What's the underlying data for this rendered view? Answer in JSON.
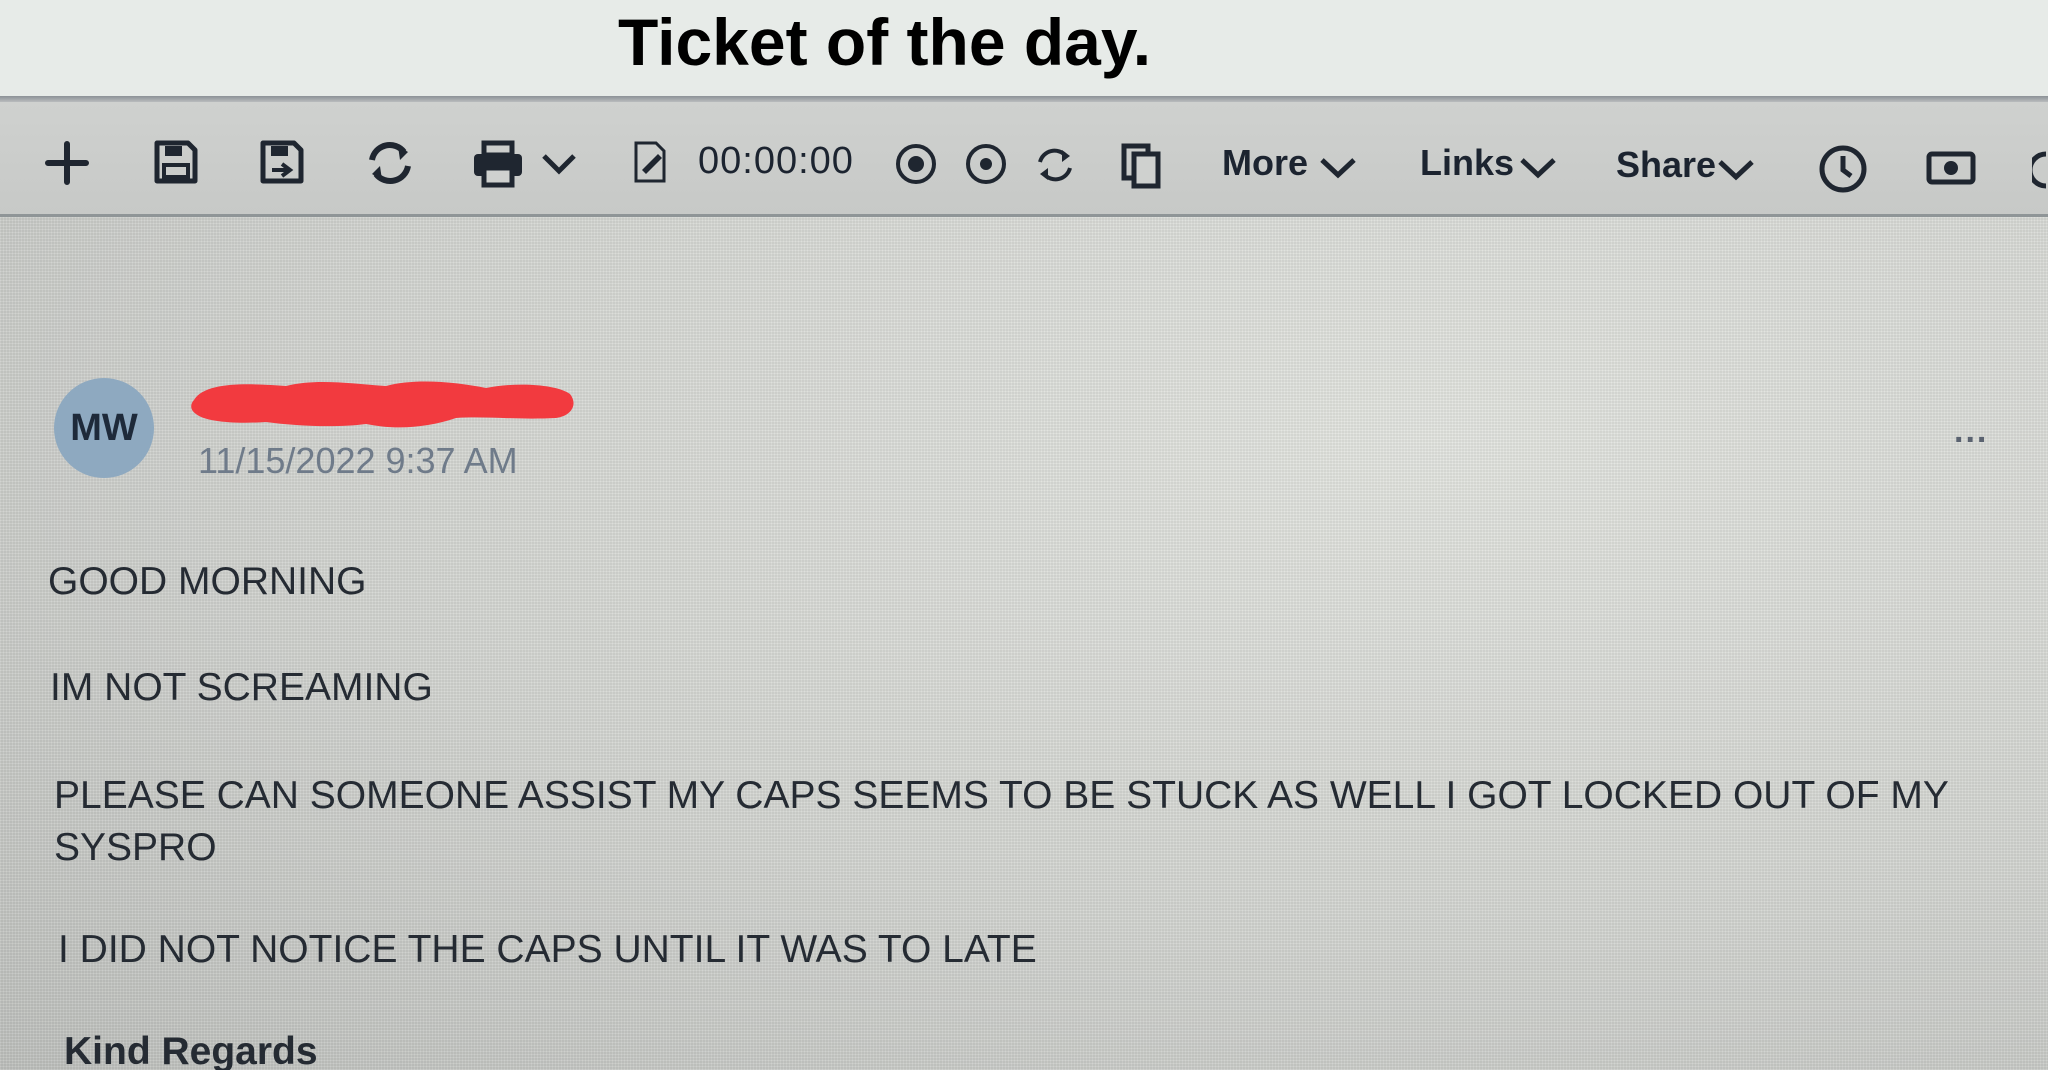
{
  "caption": "Ticket of the day.",
  "toolbar": {
    "timer": "00:00:00",
    "more_label": "More",
    "links_label": "Links",
    "share_label": "Share",
    "icons": [
      "add-icon",
      "save-icon",
      "save-close-icon",
      "refresh-icon",
      "print-icon",
      "chevron-down-icon",
      "edit-document-icon",
      "record-icon",
      "stop-icon",
      "reset-icon",
      "copy-icon",
      "clock-icon",
      "camera-icon"
    ]
  },
  "ticket": {
    "avatar_initials": "MW",
    "timestamp": "11/15/2022 9:37 AM",
    "more_actions": "...",
    "lines": [
      "GOOD MORNING",
      "IM NOT SCREAMING",
      "PLEASE CAN SOMEONE ASSIST MY CAPS SEEMS TO BE STUCK AS WELL I GOT LOCKED OUT OF MY SYSPRO",
      "I DID NOT NOTICE THE CAPS UNTIL IT WAS TO LATE"
    ],
    "signoff": "Kind Regards"
  },
  "colors": {
    "caption_bg": "#e7ebe8",
    "redaction": "#f23a3f",
    "avatar_bg": "#8ea9c0",
    "timestamp": "#6f7b8a"
  }
}
